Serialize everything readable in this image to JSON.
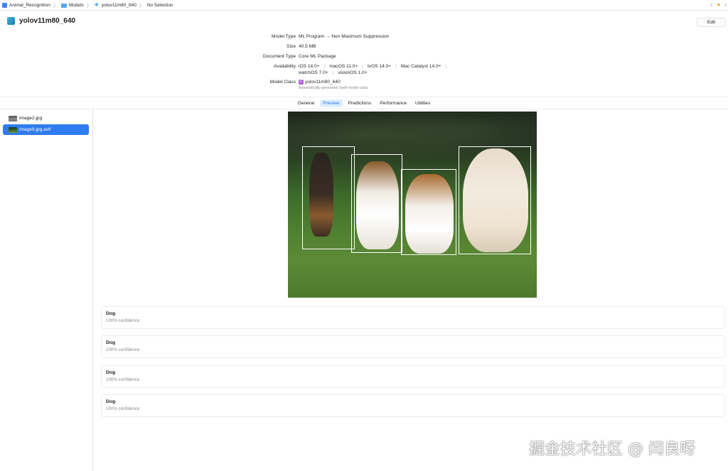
{
  "breadcrumb": {
    "items": [
      "Animal_Recognition",
      "Models",
      "yolov11m80_640",
      "No Selection"
    ]
  },
  "header": {
    "title": "yolov11m80_640",
    "edit_label": "Edit"
  },
  "metadata": {
    "model_type": {
      "label": "Model Type",
      "value": "ML Program → Non Maximum Suppression"
    },
    "size": {
      "label": "Size",
      "value": "40.5 MB"
    },
    "document_type": {
      "label": "Document Type",
      "value": "Core ML Package"
    },
    "availability": {
      "label": "Availability",
      "line1": [
        "iOS 14.0+",
        "macOS 11.0+",
        "tvOS 14.0+",
        "Mac Catalyst 14.0+"
      ],
      "line2": [
        "watchOS 7.0+",
        "visionOS 1.0+"
      ]
    },
    "model_class": {
      "label": "Model Class",
      "badge": "C",
      "value": "yolov11m80_640",
      "note": "Automatically generated Swift model class"
    }
  },
  "tabs": [
    {
      "label": "General",
      "active": false
    },
    {
      "label": "Preview",
      "active": true
    },
    {
      "label": "Predictions",
      "active": false
    },
    {
      "label": "Performance",
      "active": false
    },
    {
      "label": "Utilities",
      "active": false
    }
  ],
  "sidebar": {
    "items": [
      {
        "label": "image2.jpg",
        "selected": false
      },
      {
        "label": "image9.jpg.avif",
        "selected": true
      }
    ]
  },
  "results": [
    {
      "label": "Dog",
      "confidence": "100% confidence"
    },
    {
      "label": "Dog",
      "confidence": "100% confidence"
    },
    {
      "label": "Dog",
      "confidence": "100% confidence"
    },
    {
      "label": "Dog",
      "confidence": "100% confidence"
    }
  ],
  "colors": {
    "accent": "#2f7cf0",
    "tab_active_bg": "#dfeeff",
    "class_badge": "#b25ed8",
    "bbox": "#ffffff"
  },
  "watermark": "掘金技术社区 @ 闫良呀"
}
